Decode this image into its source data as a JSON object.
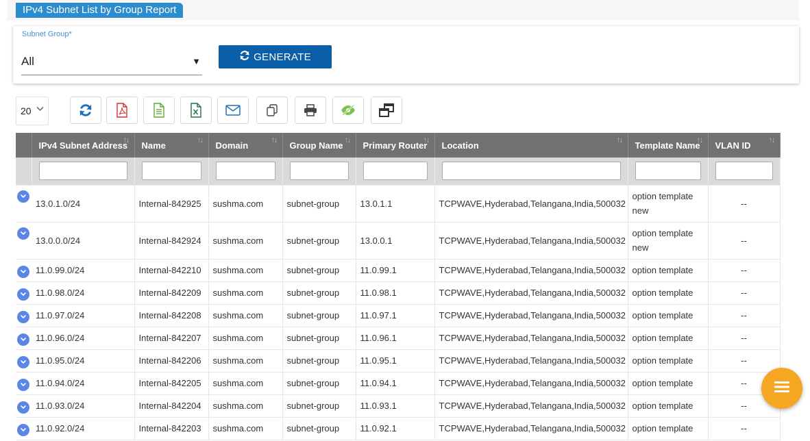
{
  "report": {
    "title": "IPv4 Subnet List by Group Report"
  },
  "filter": {
    "label": "Subnet Group*",
    "selected": "All",
    "caret": "▼",
    "generate_label": "GENERATE"
  },
  "toolbar": {
    "page_size": "20",
    "buttons": [
      "refresh-icon",
      "pdf-icon",
      "csv-icon",
      "excel-icon",
      "email-icon",
      "copy-icon",
      "print-icon",
      "column-visibility-icon",
      "restore-icon"
    ]
  },
  "table": {
    "columns": [
      "",
      "IPv4 Subnet Address",
      "Name",
      "Domain",
      "Group Name",
      "Primary Router",
      "Location",
      "Template Name",
      "VLAN ID"
    ],
    "sort_glyph": "↑↓",
    "rows": [
      {
        "subnet": "13.0.1.0/24",
        "name": "Internal-842925",
        "domain": "sushma.com",
        "group": "subnet-group",
        "router": "13.0.1.1",
        "location": "TCPWAVE,Hyderabad,Telangana,India,500032",
        "template": "option template new",
        "vlan": "--"
      },
      {
        "subnet": "13.0.0.0/24",
        "name": "Internal-842924",
        "domain": "sushma.com",
        "group": "subnet-group",
        "router": "13.0.0.1",
        "location": "TCPWAVE,Hyderabad,Telangana,India,500032",
        "template": "option template new",
        "vlan": "--"
      },
      {
        "subnet": "11.0.99.0/24",
        "name": "Internal-842210",
        "domain": "sushma.com",
        "group": "subnet-group",
        "router": "11.0.99.1",
        "location": "TCPWAVE,Hyderabad,Telangana,India,500032",
        "template": "option template",
        "vlan": "--"
      },
      {
        "subnet": "11.0.98.0/24",
        "name": "Internal-842209",
        "domain": "sushma.com",
        "group": "subnet-group",
        "router": "11.0.98.1",
        "location": "TCPWAVE,Hyderabad,Telangana,India,500032",
        "template": "option template",
        "vlan": "--"
      },
      {
        "subnet": "11.0.97.0/24",
        "name": "Internal-842208",
        "domain": "sushma.com",
        "group": "subnet-group",
        "router": "11.0.97.1",
        "location": "TCPWAVE,Hyderabad,Telangana,India,500032",
        "template": "option template",
        "vlan": "--"
      },
      {
        "subnet": "11.0.96.0/24",
        "name": "Internal-842207",
        "domain": "sushma.com",
        "group": "subnet-group",
        "router": "11.0.96.1",
        "location": "TCPWAVE,Hyderabad,Telangana,India,500032",
        "template": "option template",
        "vlan": "--"
      },
      {
        "subnet": "11.0.95.0/24",
        "name": "Internal-842206",
        "domain": "sushma.com",
        "group": "subnet-group",
        "router": "11.0.95.1",
        "location": "TCPWAVE,Hyderabad,Telangana,India,500032",
        "template": "option template",
        "vlan": "--"
      },
      {
        "subnet": "11.0.94.0/24",
        "name": "Internal-842205",
        "domain": "sushma.com",
        "group": "subnet-group",
        "router": "11.0.94.1",
        "location": "TCPWAVE,Hyderabad,Telangana,India,500032",
        "template": "option template",
        "vlan": "--"
      },
      {
        "subnet": "11.0.93.0/24",
        "name": "Internal-842204",
        "domain": "sushma.com",
        "group": "subnet-group",
        "router": "11.0.93.1",
        "location": "TCPWAVE,Hyderabad,Telangana,India,500032",
        "template": "option template",
        "vlan": "--"
      },
      {
        "subnet": "11.0.92.0/24",
        "name": "Internal-842203",
        "domain": "sushma.com",
        "group": "subnet-group",
        "router": "11.0.92.1",
        "location": "TCPWAVE,Hyderabad,Telangana,India,500032",
        "template": "option template",
        "vlan": "--"
      }
    ]
  },
  "fab": {
    "icon": "menu-icon"
  },
  "colors": {
    "tab": "#2d8ccd",
    "generate": "#0a5fa8",
    "header": "#717171",
    "expander": "#5b86e5",
    "fab": "#f5a623"
  }
}
